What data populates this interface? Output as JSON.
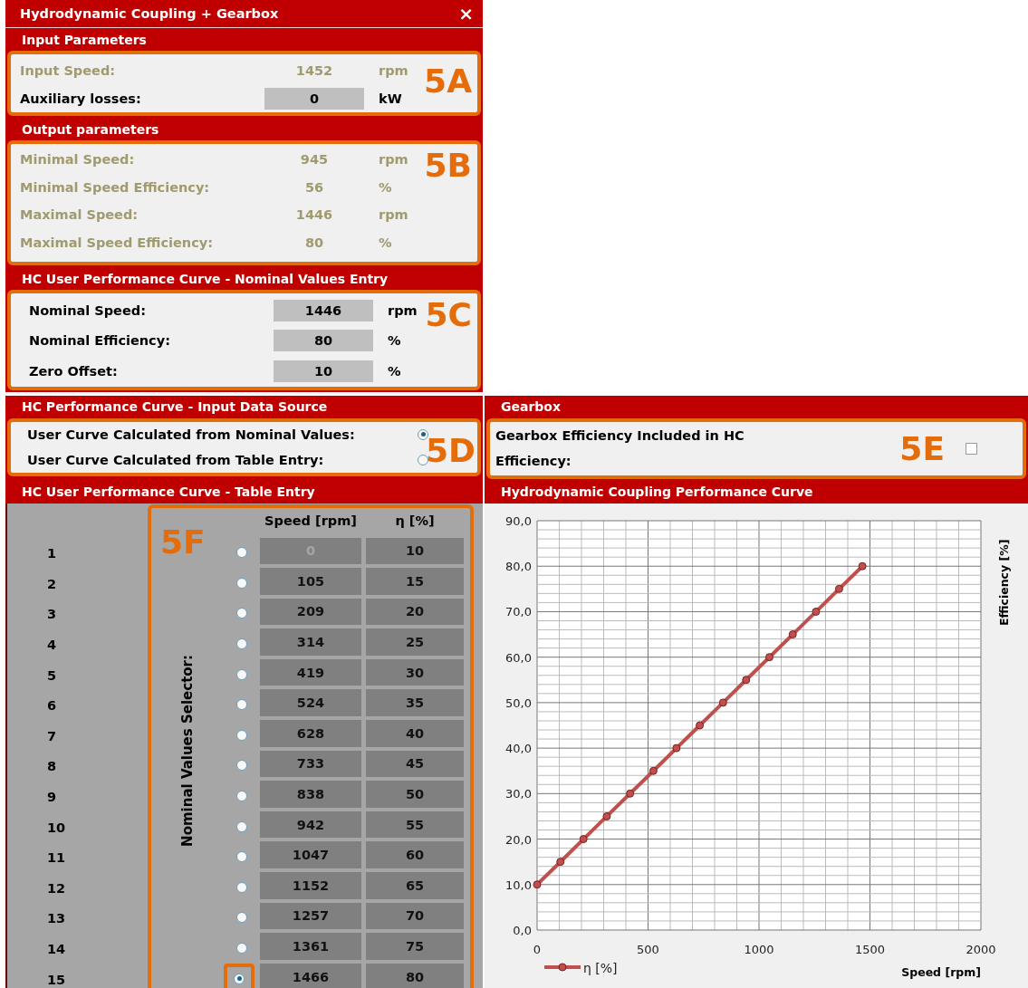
{
  "window": {
    "title": "Hydrodynamic Coupling + Gearbox",
    "close": "×"
  },
  "input_parameters": {
    "title": "Input  Parameters",
    "callout": "5A",
    "rows": [
      {
        "label": "Input Speed:",
        "value": "1452",
        "unit": "rpm",
        "kind": "readout"
      },
      {
        "label": "Auxiliary losses:",
        "value": "0",
        "unit": "kW",
        "kind": "field"
      }
    ]
  },
  "output_parameters": {
    "title": "Output parameters",
    "callout": "5B",
    "rows": [
      {
        "label": "Minimal Speed:",
        "value": "945",
        "unit": "rpm",
        "kind": "readout"
      },
      {
        "label": "Minimal Speed Efficiency:",
        "value": "56",
        "unit": "%",
        "kind": "readout"
      },
      {
        "label": "Maximal Speed:",
        "value": "1446",
        "unit": "rpm",
        "kind": "readout"
      },
      {
        "label": "Maximal Speed Efficiency:",
        "value": "80",
        "unit": "%",
        "kind": "readout"
      }
    ]
  },
  "nominal_values": {
    "title": "HC User  Performance Curve - Nominal Values Entry",
    "callout": "5C",
    "rows": [
      {
        "label": "Nominal Speed:",
        "value": "1446",
        "unit": "rpm",
        "kind": "field"
      },
      {
        "label": "Nominal Efficiency:",
        "value": "80",
        "unit": "%",
        "kind": "field"
      },
      {
        "label": "Zero Offset:",
        "value": "10",
        "unit": "%",
        "kind": "field"
      }
    ]
  },
  "data_source": {
    "title": "HC Performance Curve - Input Data Source",
    "callout": "5D",
    "options": [
      {
        "label": "User  Curve Calculated from Nominal Values:",
        "selected": true
      },
      {
        "label": "User  Curve Calculated from Table Entry:",
        "selected": false
      }
    ]
  },
  "gearbox": {
    "title": "Gearbox",
    "callout": "5E",
    "label": "Gearbox Efficiency Included in HC Efficiency:",
    "checked": false
  },
  "table": {
    "title": "HC User  Performance Curve - Table Entry",
    "callout": "5F",
    "selector_label": "Nominal Values Selector:",
    "columns": [
      "Speed [rpm]",
      "η [%]"
    ],
    "rows": [
      {
        "index": "1",
        "selected": false,
        "speed": "0",
        "eta": "10",
        "speed_disabled": true
      },
      {
        "index": "2",
        "selected": false,
        "speed": "105",
        "eta": "15",
        "speed_disabled": false
      },
      {
        "index": "3",
        "selected": false,
        "speed": "209",
        "eta": "20",
        "speed_disabled": false
      },
      {
        "index": "4",
        "selected": false,
        "speed": "314",
        "eta": "25",
        "speed_disabled": false
      },
      {
        "index": "5",
        "selected": false,
        "speed": "419",
        "eta": "30",
        "speed_disabled": false
      },
      {
        "index": "6",
        "selected": false,
        "speed": "524",
        "eta": "35",
        "speed_disabled": false
      },
      {
        "index": "7",
        "selected": false,
        "speed": "628",
        "eta": "40",
        "speed_disabled": false
      },
      {
        "index": "8",
        "selected": false,
        "speed": "733",
        "eta": "45",
        "speed_disabled": false
      },
      {
        "index": "9",
        "selected": false,
        "speed": "838",
        "eta": "50",
        "speed_disabled": false
      },
      {
        "index": "10",
        "selected": false,
        "speed": "942",
        "eta": "55",
        "speed_disabled": false
      },
      {
        "index": "11",
        "selected": false,
        "speed": "1047",
        "eta": "60",
        "speed_disabled": false
      },
      {
        "index": "12",
        "selected": false,
        "speed": "1152",
        "eta": "65",
        "speed_disabled": false
      },
      {
        "index": "13",
        "selected": false,
        "speed": "1257",
        "eta": "70",
        "speed_disabled": false
      },
      {
        "index": "14",
        "selected": false,
        "speed": "1361",
        "eta": "75",
        "speed_disabled": false
      },
      {
        "index": "15",
        "selected": true,
        "speed": "1466",
        "eta": "80",
        "speed_disabled": false
      }
    ]
  },
  "chart": {
    "title": "Hydrodynamic Coupling Performance Curve",
    "chart_data": {
      "type": "line",
      "xlabel": "Speed [rpm]",
      "ylabel": "Efficiency  [%]",
      "x": [
        0,
        105,
        209,
        314,
        419,
        524,
        628,
        733,
        838,
        942,
        1047,
        1152,
        1257,
        1361,
        1466
      ],
      "grid": true,
      "series": [
        {
          "name": "η [%]",
          "color": "#c0504d",
          "marker": "circle",
          "values": [
            10,
            15,
            20,
            25,
            30,
            35,
            40,
            45,
            50,
            55,
            60,
            65,
            70,
            75,
            80
          ]
        }
      ],
      "xlim": [
        0,
        2000
      ],
      "ylim": [
        0,
        90
      ],
      "xticks": [
        0,
        500,
        1000,
        1500,
        2000
      ],
      "yticks": [
        {
          "value": 0,
          "label": "0,0"
        },
        {
          "value": 10,
          "label": "10,0"
        },
        {
          "value": 20,
          "label": "20,0"
        },
        {
          "value": 30,
          "label": "30,0"
        },
        {
          "value": 40,
          "label": "40,0"
        },
        {
          "value": 50,
          "label": "50,0"
        },
        {
          "value": 60,
          "label": "60,0"
        },
        {
          "value": 70,
          "label": "70,0"
        },
        {
          "value": 80,
          "label": "80,0"
        },
        {
          "value": 90,
          "label": "90,0"
        }
      ]
    }
  }
}
